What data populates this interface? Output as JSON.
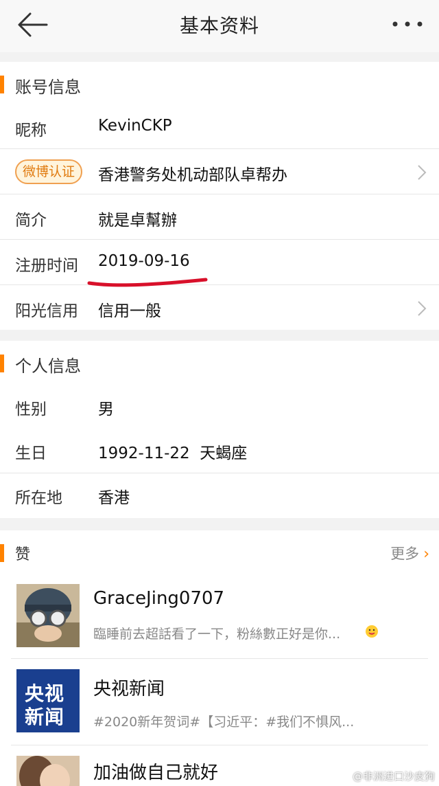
{
  "header": {
    "title": "基本资料"
  },
  "account": {
    "section_title": "账号信息",
    "nickname_label": "昵称",
    "nickname": "KevinCKP",
    "verify_badge": "微博认证",
    "verify_text": "香港警务处机动部队卓帮办",
    "intro_label": "简介",
    "intro": "就是卓幫辦",
    "register_label": "注册时间",
    "register_date": "2019-09-16",
    "credit_label": "阳光信用",
    "credit": "信用一般"
  },
  "personal": {
    "section_title": "个人信息",
    "gender_label": "性别",
    "gender": "男",
    "birthday_label": "生日",
    "birthday": "1992-11-22  天蝎座",
    "location_label": "所在地",
    "location": "香港"
  },
  "likes": {
    "section_title": "赞",
    "more": "更多",
    "items": [
      {
        "name": "GraceJing0707",
        "desc": "臨睡前去超話看了一下，粉絲數正好是你..."
      },
      {
        "name": "央视新闻",
        "desc": "#2020新年贺词#【习近平：#我们不惧风...",
        "logo_top": "央视",
        "logo_bottom": "新闻"
      },
      {
        "name": "加油做自己就好",
        "desc": ""
      }
    ]
  },
  "watermark": "@非洲进口沙皮狗",
  "colors": {
    "accent": "#ff8200",
    "annotation": "#d8102a",
    "badge_border": "#f0a050"
  }
}
